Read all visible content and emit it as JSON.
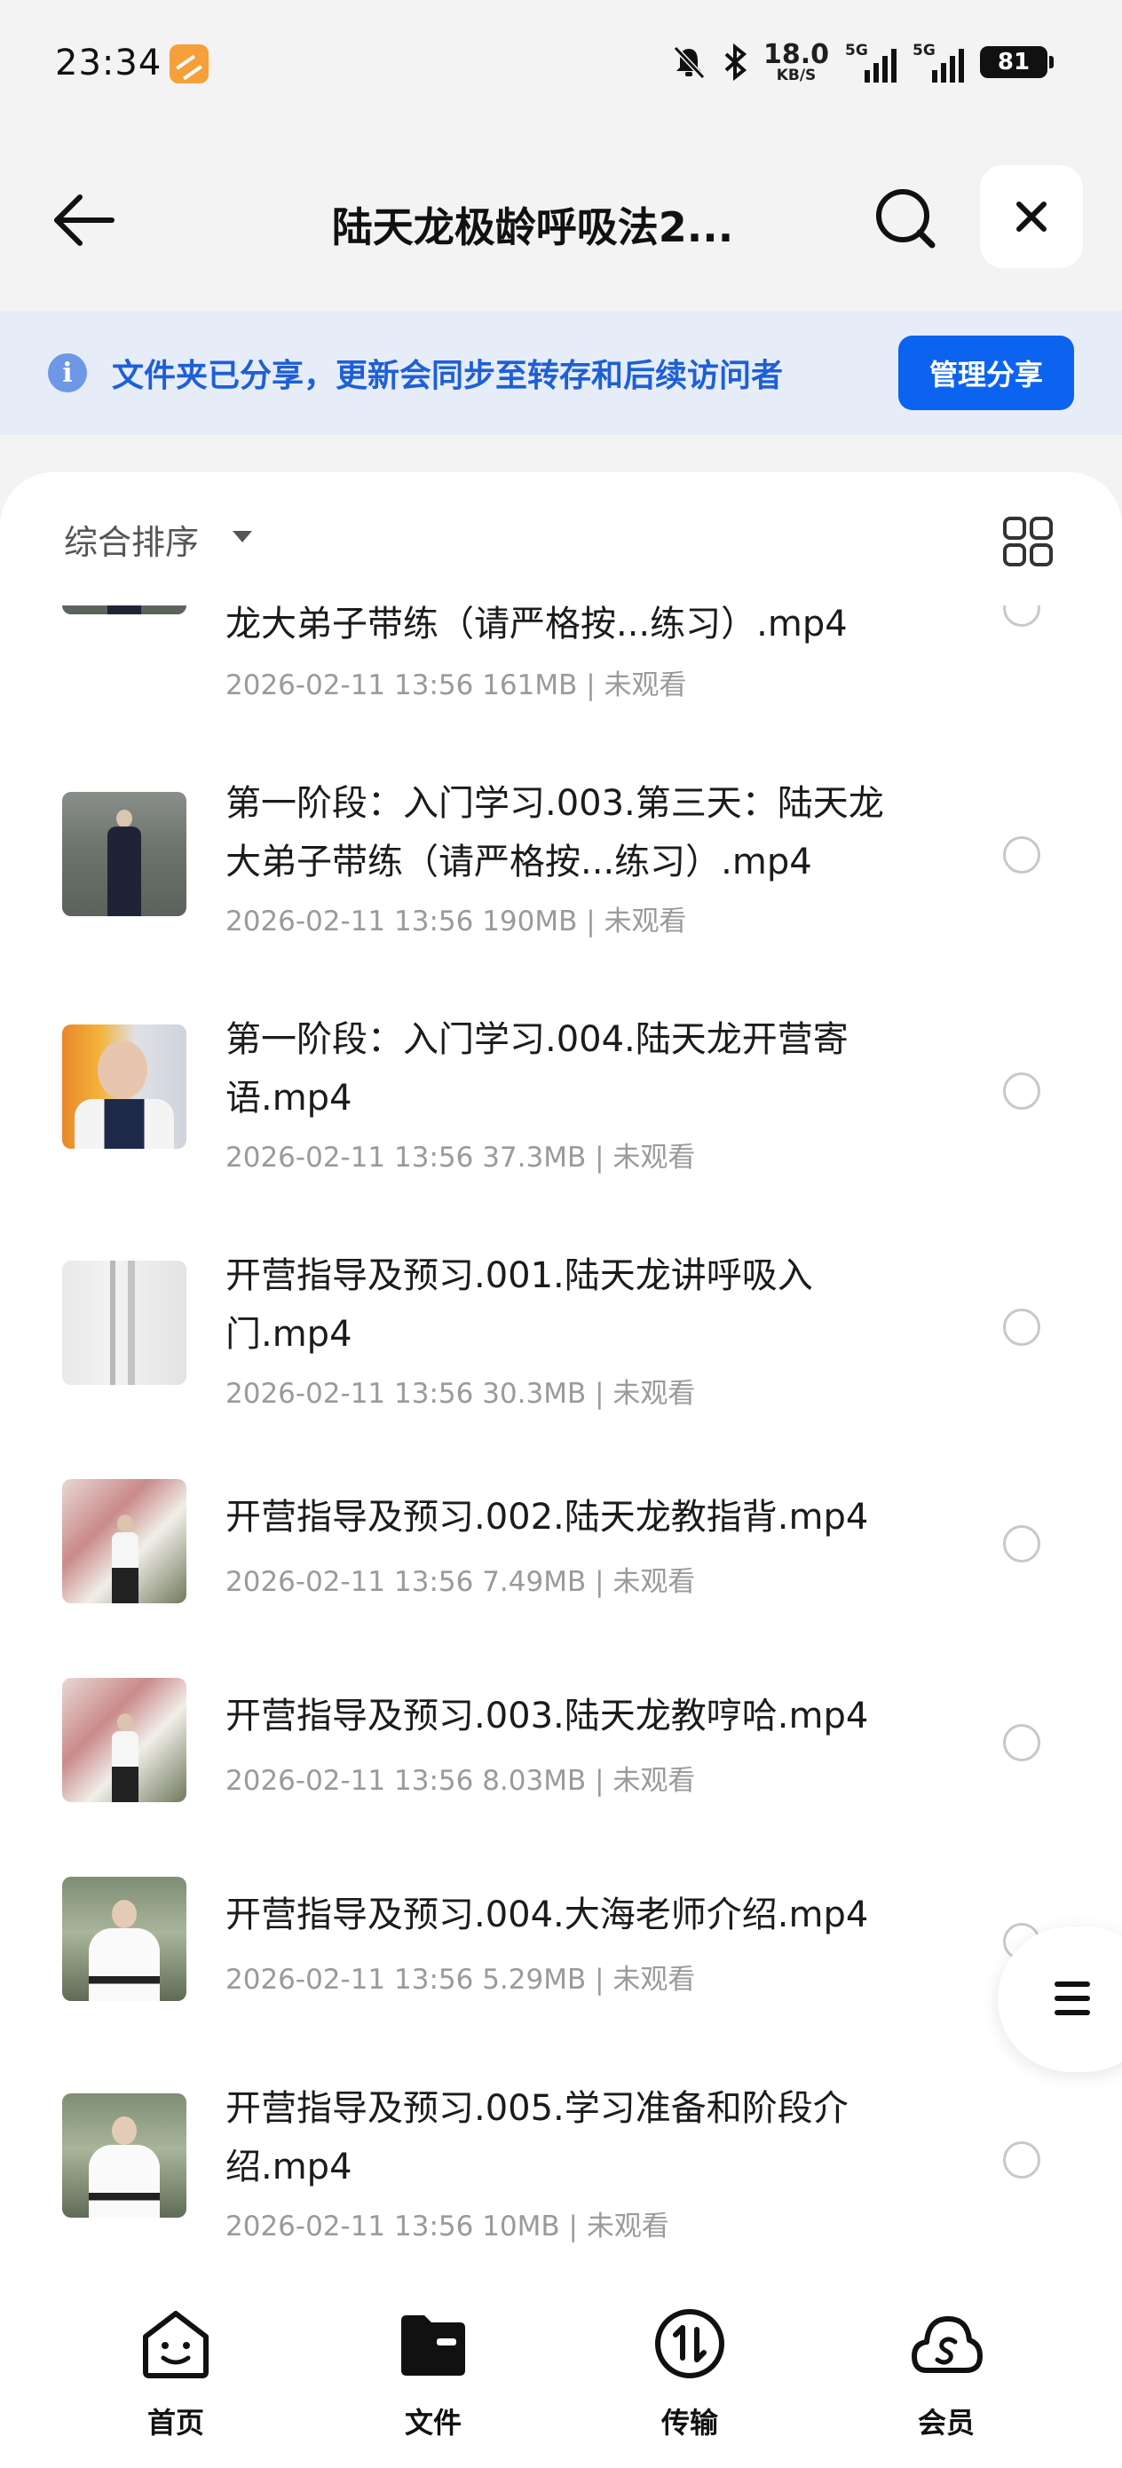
{
  "status_bar": {
    "time": "23:34",
    "speed_value": "18.0",
    "speed_unit": "KB/S",
    "signal1_tag": "5G",
    "signal2_tag": "5G",
    "battery": "81"
  },
  "header": {
    "title": "陆天龙极龄呼吸法2..."
  },
  "share_banner": {
    "text": "文件夹已分享，更新会同步至转存和后续访问者",
    "manage_button": "管理分享"
  },
  "sort": {
    "label": "综合排序"
  },
  "files": [
    {
      "name": "龙大弟子带练（请严格按...练习）.mp4",
      "meta": "2026-02-11 13:56  161MB | 未观看",
      "thumb": "man-dark-robe"
    },
    {
      "name": "第一阶段：入门学习.003.第三天：陆天龙大弟子带练（请严格按...练习）.mp4",
      "meta": "2026-02-11 13:56  190MB | 未观看",
      "thumb": "man-dark-robe"
    },
    {
      "name": "第一阶段：入门学习.004.陆天龙开营寄语.mp4",
      "meta": "2026-02-11 13:56  37.3MB | 未观看",
      "thumb": "elder-portrait"
    },
    {
      "name": "开营指导及预习.001.陆天龙讲呼吸入门.mp4",
      "meta": "2026-02-11 13:56  30.3MB | 未观看",
      "thumb": "grey-frame"
    },
    {
      "name": "开营指导及预习.002.陆天龙教指背.mp4",
      "meta": "2026-02-11 13:56  7.49MB | 未观看",
      "thumb": "man-mural"
    },
    {
      "name": "开营指导及预习.003.陆天龙教哼哈.mp4",
      "meta": "2026-02-11 13:56  8.03MB | 未观看",
      "thumb": "man-mural"
    },
    {
      "name": "开营指导及预习.004.大海老师介绍.mp4",
      "meta": "2026-02-11 13:56  5.29MB | 未观看",
      "thumb": "man-white-robe"
    },
    {
      "name": "开营指导及预习.005.学习准备和阶段介绍.mp4",
      "meta": "2026-02-11 13:56  10MB | 未观看",
      "thumb": "man-white-robe"
    }
  ],
  "nav": [
    {
      "label": "首页",
      "icon": "smile-home-icon"
    },
    {
      "label": "文件",
      "icon": "folder-icon"
    },
    {
      "label": "传输",
      "icon": "transfer-icon"
    },
    {
      "label": "会员",
      "icon": "cloud-member-icon"
    }
  ]
}
